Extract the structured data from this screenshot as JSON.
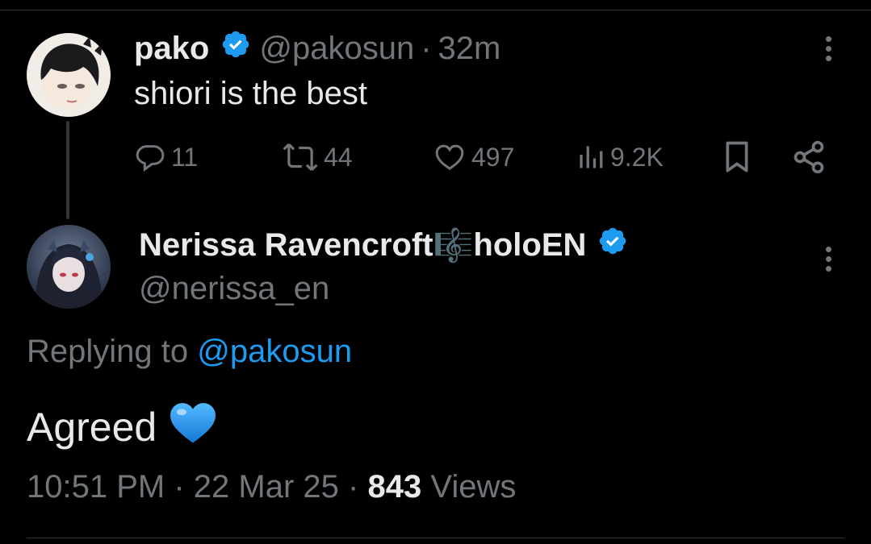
{
  "parent_post": {
    "display_name": "pako",
    "handle": "@pakosun",
    "separator": "·",
    "time_ago": "32m",
    "text": "shiori is the best",
    "actions": {
      "replies": "11",
      "reposts": "44",
      "likes": "497",
      "views": "9.2K"
    }
  },
  "reply_post": {
    "display_name_part1": "Nerissa Ravencroft",
    "name_symbol": "🎼",
    "display_name_part2": "holoEN",
    "handle": "@nerissa_en",
    "replying_to_label": "Replying to",
    "replying_to_handle": "@pakosun",
    "text": "Agreed",
    "emoji": "💙",
    "time": "10:51 PM",
    "separator": "·",
    "date": "22 Mar 25",
    "views_count": "843",
    "views_label": "Views"
  },
  "colors": {
    "background": "#000000",
    "text_primary": "#e7e9ea",
    "text_secondary": "#71767b",
    "accent": "#1d9bf0",
    "divider": "#2f3336"
  },
  "icons": {
    "verified": "verified-badge-icon",
    "more": "more-options-icon",
    "reply": "reply-icon",
    "repost": "repost-icon",
    "like": "like-icon",
    "views": "views-icon",
    "bookmark": "bookmark-icon",
    "share": "share-icon"
  }
}
